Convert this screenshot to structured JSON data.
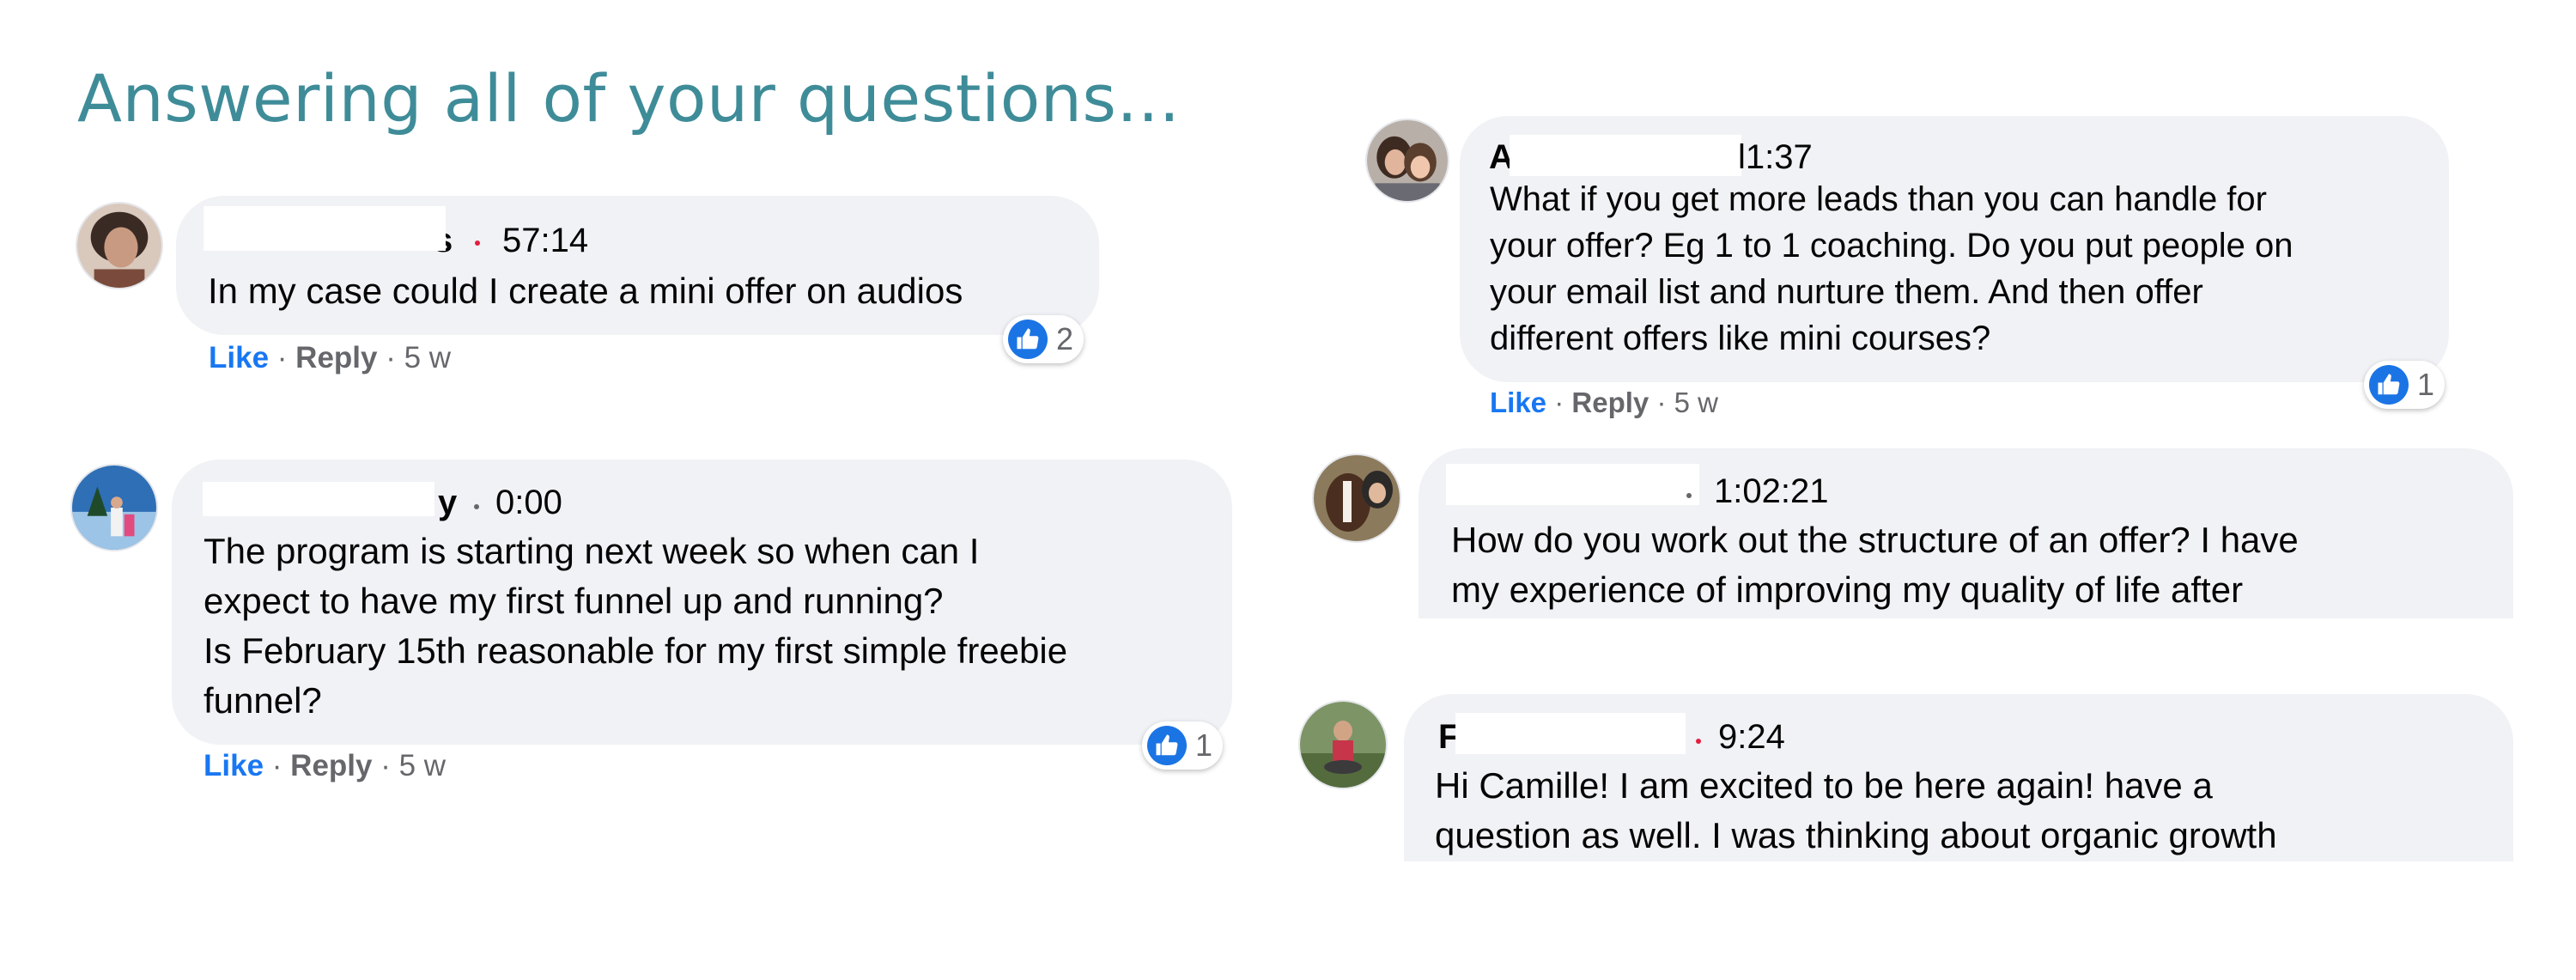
{
  "title": "Answering all of your questions...",
  "comments": [
    {
      "name_visible": "s",
      "timestamp": "57:14",
      "body": "In my case could I create a mini offer on audios",
      "like": "Like",
      "reply": "Reply",
      "age": "5 w",
      "reactions": "2"
    },
    {
      "name_visible": "y",
      "timestamp": "0:00",
      "body": "The program is starting next week so when can I\nexpect to have my first funnel up and running?\nIs February 15th reasonable for my first simple freebie\nfunnel?",
      "like": "Like",
      "reply": "Reply",
      "age": "5 w",
      "reactions": "1"
    },
    {
      "name_visible": "A",
      "timestamp": "l1:37",
      "body": "What if you get more leads than you can handle for\nyour offer? Eg 1 to 1 coaching. Do you put people on\nyour email list and nurture them. And then offer\ndifferent offers like mini courses?",
      "like": "Like",
      "reply": "Reply",
      "age": "5 w",
      "reactions": "1"
    },
    {
      "name_visible": "",
      "timestamp": "1:02:21",
      "body": "How do you work out the structure of an offer? I have\nmy experience of improving my quality of life after"
    },
    {
      "name_visible": "F",
      "timestamp": "9:24",
      "body": "Hi Camille! I am excited to be here again! have a\nquestion as well. I was thinking about organic growth"
    }
  ],
  "colors": {
    "title": "#3f8c99",
    "bubble": "#f0f2f5",
    "like": "#1877f2",
    "reaction": "#1b74e4",
    "dot_red": "#e41e3f",
    "dot_gray": "#65676b"
  },
  "icons": {
    "reaction": "thumbs-up-icon"
  }
}
